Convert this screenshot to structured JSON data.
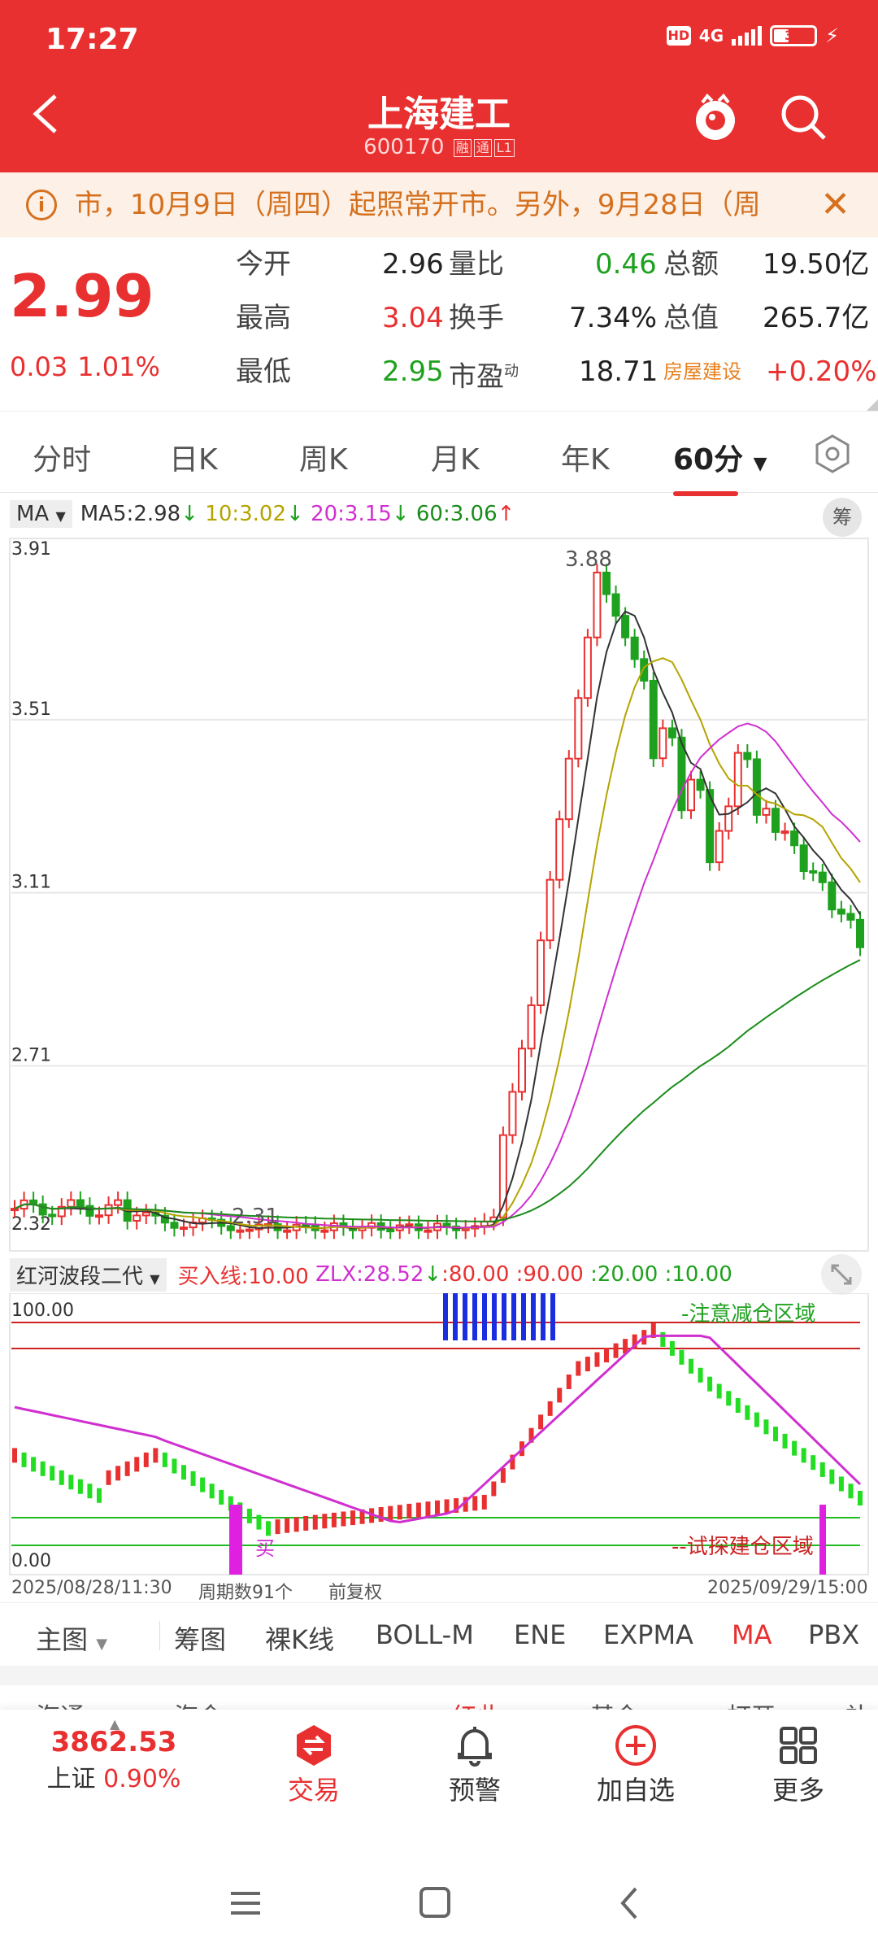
{
  "status": {
    "time": "17:27",
    "hd": "HD",
    "network": "4G",
    "battery": "35"
  },
  "header": {
    "title": "上海建工",
    "code": "600170",
    "tag1": "融",
    "tag2": "通",
    "tag3": "L1"
  },
  "notice": {
    "text": "市，10月9日（周四）起照常开市。另外，9月28日（周"
  },
  "quote": {
    "price": "2.99",
    "change": "0.03",
    "change_pct": "1.01%",
    "rows": [
      [
        {
          "label": "今开",
          "value": "2.96"
        },
        {
          "label": "量比",
          "value": "0.46"
        },
        {
          "label": "总额",
          "value": "19.50亿"
        }
      ],
      [
        {
          "label": "最高",
          "value": "3.04"
        },
        {
          "label": "换手",
          "value": "7.34%"
        },
        {
          "label": "总值",
          "value": "265.7亿"
        }
      ],
      [
        {
          "label": "最低",
          "value": "2.95"
        },
        {
          "label": "市盈",
          "sup": "动",
          "value": "18.71"
        },
        {
          "label": "房屋建设",
          "value": "+0.20%"
        }
      ]
    ]
  },
  "tabs": [
    "分时",
    "日K",
    "周K",
    "月K",
    "年K",
    "60分"
  ],
  "ma_legend": {
    "name": "MA",
    "ma5": "MA5:2.98",
    "ma10": "10:3.02",
    "ma20": "20:3.15",
    "ma60": "60:3.06",
    "chou": "筹"
  },
  "chart_data": [
    {
      "type": "candlestick",
      "title": "",
      "ylim": [
        2.32,
        3.91
      ],
      "y_ticks": [
        "3.91",
        "3.51",
        "3.11",
        "2.71",
        "2.32"
      ],
      "annotations": [
        "3.88",
        "2.31"
      ],
      "series": [
        {
          "name": "MA5",
          "value": 2.98,
          "color": "#333333"
        },
        {
          "name": "10",
          "value": 3.02,
          "color": "#b5a400"
        },
        {
          "name": "20",
          "value": 3.15,
          "color": "#d02fd0"
        },
        {
          "name": "60",
          "value": 3.06,
          "color": "#1a8c1a"
        }
      ]
    },
    {
      "type": "line",
      "title": "红河波段二代",
      "ylim": [
        0,
        100
      ],
      "y_ticks": [
        "100.00",
        "0.00"
      ],
      "params": [
        "买入线:10.00",
        "ZLX:28.52",
        ":80.00",
        ":90.00",
        ":20.00",
        ":10.00"
      ],
      "annotations": [
        "-注意减仓区域",
        "--试探建仓区域",
        "买"
      ]
    }
  ],
  "indicator": {
    "name": "红河波段二代",
    "buy": "买入线:10.00",
    "zlx": "ZLX:28.52",
    "p80": ":80.00",
    "p90": ":90.00",
    "p20": ":20.00",
    "p10": ":10.00",
    "top_note": "-注意减仓区域",
    "bottom_note": "--试探建仓区域",
    "buy_mark": "买",
    "tick_high": "100.00",
    "tick_low": "0.00"
  },
  "footer": {
    "start": "2025/08/28/11:30",
    "count": "周期数91个",
    "adj": "前复权",
    "end": "2025/09/29/15:00"
  },
  "indicator_tabs": [
    "主图",
    "筹图",
    "裸K线",
    "BOLL-M",
    "ENE",
    "EXPMA",
    "MA",
    "PBX"
  ],
  "partial_row": [
    "海通",
    "海金",
    "红此",
    "基金",
    "打开",
    "补"
  ],
  "bottom": {
    "index_value": "3862.53",
    "index_name": "上证",
    "index_pct": "0.90%",
    "trade": "交易",
    "alert": "预警",
    "add": "加自选",
    "more": "更多"
  },
  "colors": {
    "brand": "#e93030",
    "up": "#e93030",
    "down": "#1ea11e"
  }
}
